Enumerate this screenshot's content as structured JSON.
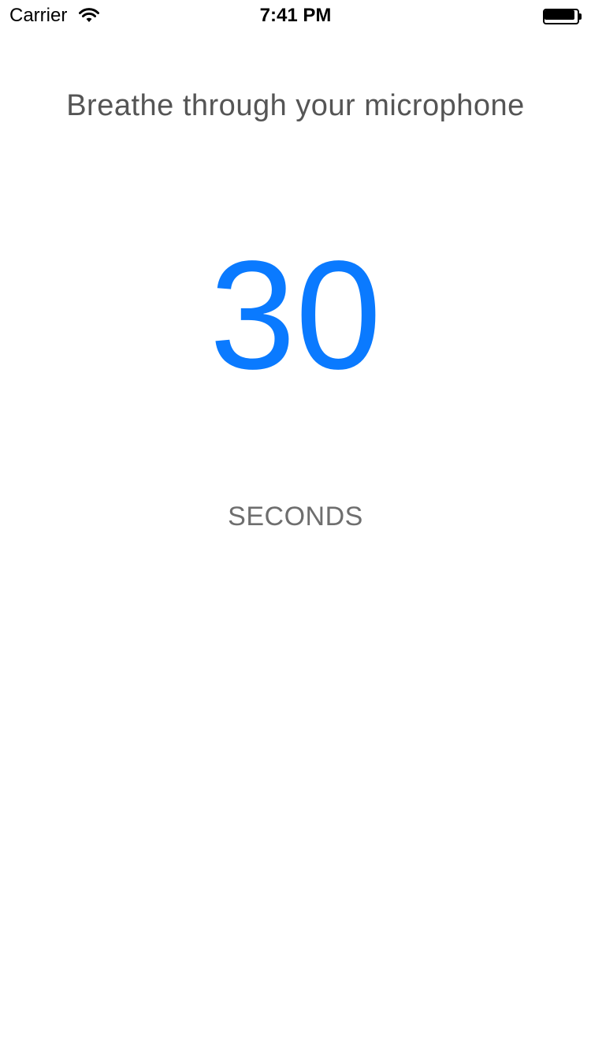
{
  "status_bar": {
    "carrier": "Carrier",
    "time": "7:41 PM",
    "wifi_icon": "wifi-icon",
    "battery_icon": "battery-icon",
    "battery_level": 1.0
  },
  "main": {
    "instruction": "Breathe through your microphone",
    "countdown_value": "30",
    "unit_label": "SECONDS"
  },
  "colors": {
    "accent": "#0a7aff",
    "instruction_text": "#555555",
    "unit_text": "#6e6e6e",
    "background": "#ffffff"
  }
}
